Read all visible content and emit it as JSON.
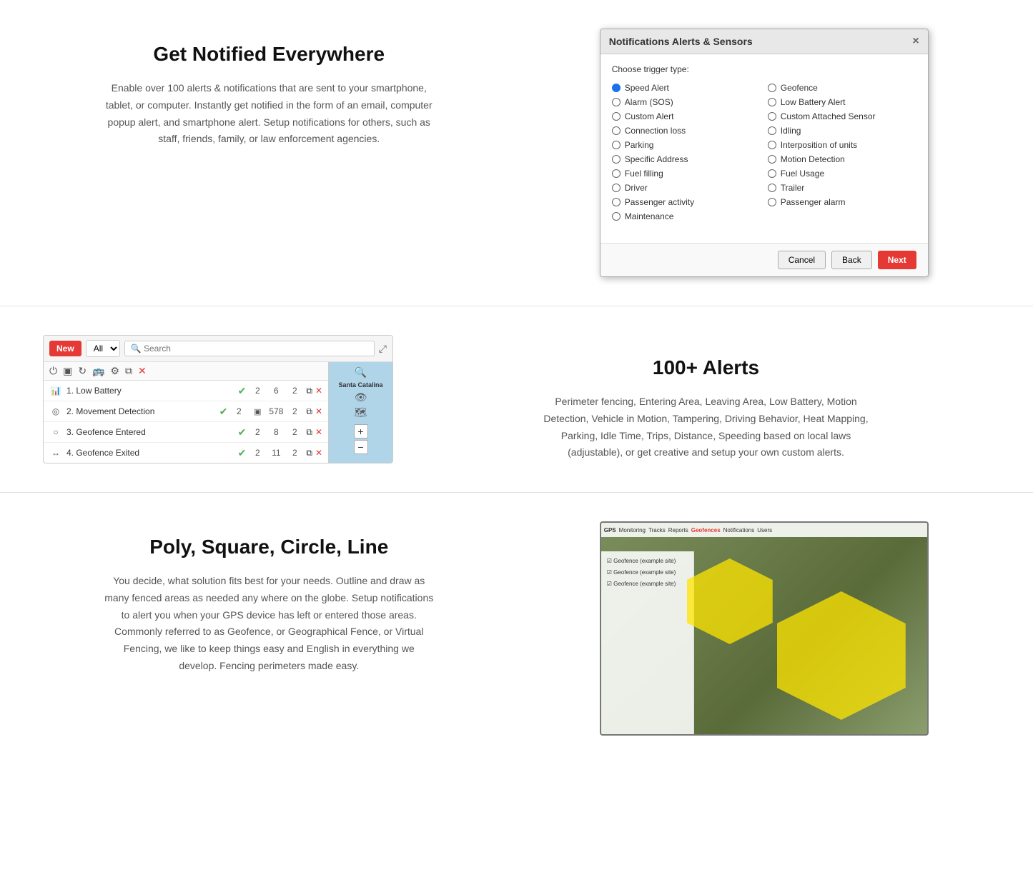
{
  "section1": {
    "title": "Get Notified Everywhere",
    "description": "Enable over 100 alerts & notifications that are sent to your smartphone, tablet, or computer. Instantly get notified in the form of an email, computer popup alert, and smartphone alert. Setup notifications for others, such as staff, friends, family, or law enforcement agencies.",
    "dialog": {
      "title": "Notifications Alerts & Sensors",
      "subtitle": "Choose trigger type:",
      "close_label": "×",
      "options_left": [
        {
          "label": "Speed Alert",
          "selected": true
        },
        {
          "label": "Alarm (SOS)",
          "selected": false
        },
        {
          "label": "Custom Alert",
          "selected": false
        },
        {
          "label": "Connection loss",
          "selected": false
        },
        {
          "label": "Parking",
          "selected": false
        },
        {
          "label": "Specific Address",
          "selected": false
        },
        {
          "label": "Fuel filling",
          "selected": false
        },
        {
          "label": "Driver",
          "selected": false
        },
        {
          "label": "Passenger activity",
          "selected": false
        },
        {
          "label": "Maintenance",
          "selected": false
        }
      ],
      "options_right": [
        {
          "label": "Geofence",
          "selected": false
        },
        {
          "label": "Low Battery Alert",
          "selected": false
        },
        {
          "label": "Custom Attached Sensor",
          "selected": false
        },
        {
          "label": "Idling",
          "selected": false
        },
        {
          "label": "Interposition of units",
          "selected": false
        },
        {
          "label": "Motion Detection",
          "selected": false
        },
        {
          "label": "Fuel Usage",
          "selected": false
        },
        {
          "label": "Trailer",
          "selected": false
        },
        {
          "label": "Passenger alarm",
          "selected": false
        }
      ],
      "btn_cancel": "Cancel",
      "btn_back": "Back",
      "btn_next": "Next"
    }
  },
  "section2": {
    "title": "100+ Alerts",
    "description": "Perimeter fencing, Entering Area, Leaving Area, Low Battery, Motion Detection, Vehicle in Motion, Tampering, Driving Behavior, Heat Mapping, Parking, Idle Time, Trips, Distance, Speeding based on local laws (adjustable), or get creative and setup your own custom alerts.",
    "panel": {
      "btn_new": "New",
      "select_placeholder": "All",
      "search_placeholder": "Search",
      "alerts": [
        {
          "icon": "bar-chart",
          "name": "1. Low Battery",
          "active": true,
          "col1": "2",
          "col2": "6",
          "col3": "2"
        },
        {
          "icon": "circle",
          "name": "2. Movement Detection",
          "active": true,
          "col1": "2",
          "col2": "578",
          "col3": "2"
        },
        {
          "icon": "circle2",
          "name": "3. Geofence Entered",
          "active": true,
          "col1": "2",
          "col2": "8",
          "col3": "2"
        },
        {
          "icon": "arrows",
          "name": "4. Geofence Exited",
          "active": true,
          "col1": "2",
          "col2": "11",
          "col3": "2"
        }
      ],
      "map_label": "Santa Catalina"
    }
  },
  "section3": {
    "title": "Poly, Square, Circle, Line",
    "description": "You decide, what solution fits best for your needs. Outline and draw as many fenced areas as needed any where on the globe. Setup notifications to alert you when your GPS device has left or entered those areas. Commonly referred to as Geofence, or Geographical Fence, or Virtual Fencing, we like to keep things easy and English in everything we develop. Fencing perimeters made easy.",
    "geo_items": [
      "Geofence (example site)",
      "Geofence (example site)",
      "Geofence (example site)"
    ]
  }
}
